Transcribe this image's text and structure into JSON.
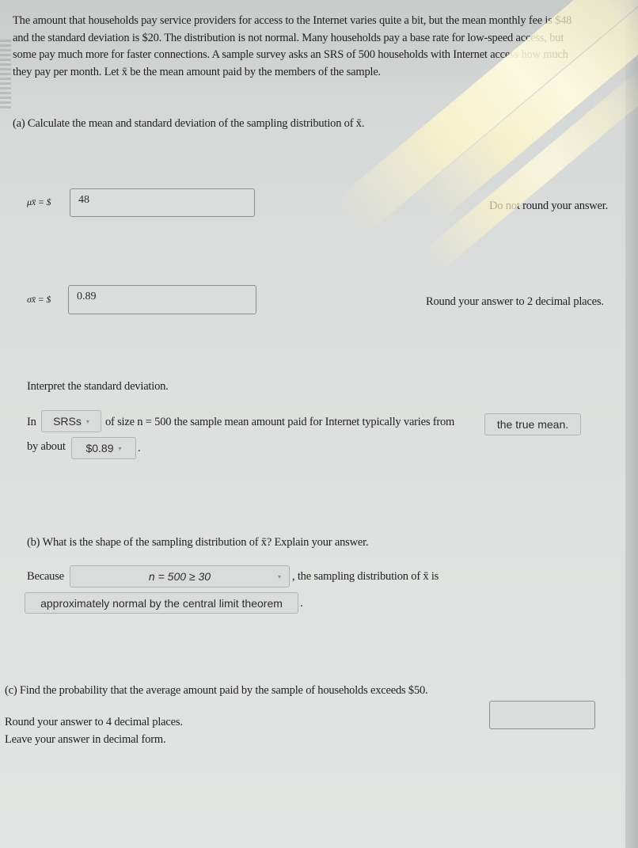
{
  "intro": {
    "lines": [
      "The amount that households pay service providers for access to the Internet varies quite a bit, but the mean monthly fee is $48",
      "and the standard deviation is $20. The distribution is not normal. Many households pay a base rate for low-speed access, but",
      "some pay much more for faster connections. A sample survey asks an SRS of 500 households with Internet access how much",
      "they pay per month. Let x̄ be the mean amount paid by the members of the sample."
    ]
  },
  "part_a": {
    "prompt": "(a) Calculate the mean and standard deviation of the sampling distribution of x̄.",
    "mean": {
      "label": "μx̄ = $",
      "value": "48",
      "hint": "Do not round your answer."
    },
    "sd": {
      "label": "σx̄ = $",
      "value": "0.89",
      "hint": "Round your answer to 2 decimal places."
    },
    "interpret": {
      "heading": "Interpret the standard deviation.",
      "text_in": "In",
      "dropdown1": "SRSs",
      "text_mid": "of size n = 500 the sample mean amount paid for Internet typically varies from",
      "dropdown2": "the true mean.",
      "text_by": "by about",
      "dropdown3": "$0.89",
      "text_end": "."
    }
  },
  "part_b": {
    "prompt": "(b) What is the shape of the sampling distribution of x̄? Explain your answer.",
    "text_because": "Because",
    "dropdown1": "n = 500 ≥ 30",
    "text_after": ", the sampling distribution of x̄ is",
    "dropdown2": "approximately normal by the central limit theorem",
    "text_end": "."
  },
  "part_c": {
    "prompt": "(c) Find the probability that the average amount paid by the sample of households exceeds $50.",
    "hint1": "Round your answer to 4 decimal places.",
    "hint2": "Leave your answer in decimal form.",
    "answer_value": ""
  },
  "icons": {
    "dropdown_caret": "▾"
  }
}
